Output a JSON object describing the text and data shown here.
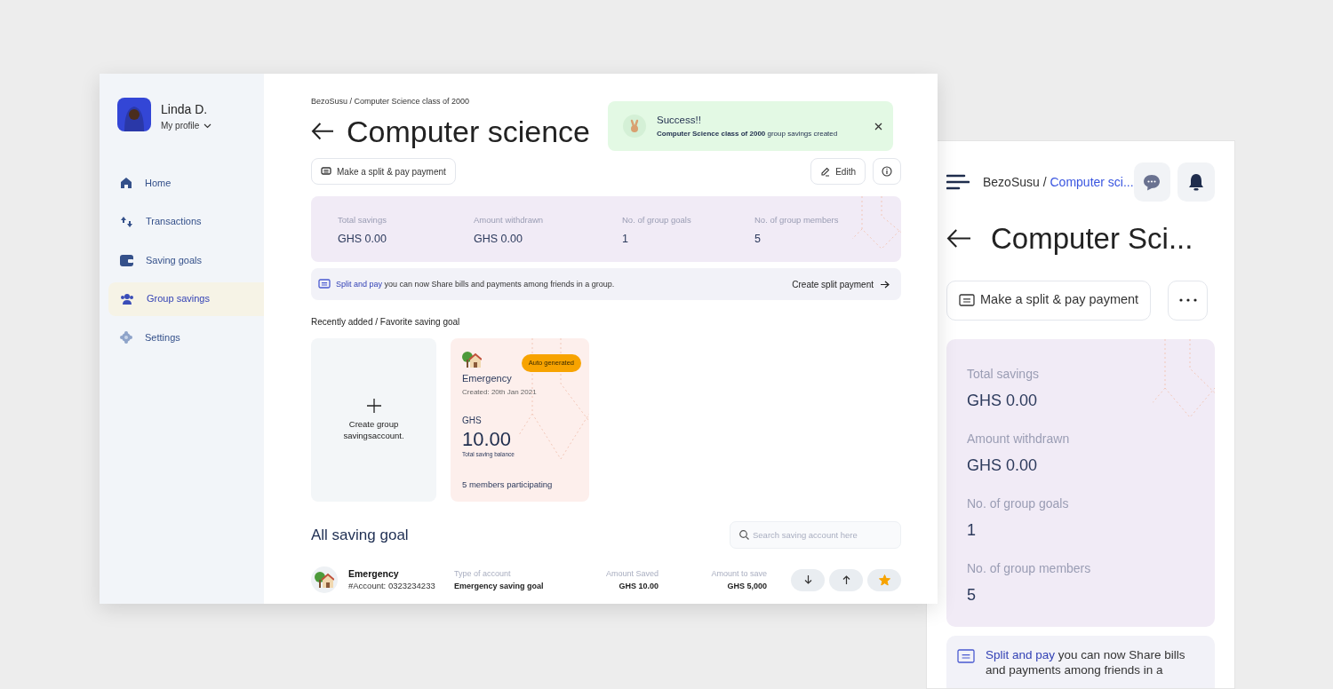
{
  "desktop": {
    "profile": {
      "name": "Linda D.",
      "link": "My profile"
    },
    "nav": [
      {
        "label": "Home",
        "kind": "home",
        "selected": false
      },
      {
        "label": "Transactions",
        "kind": "transactions",
        "selected": false
      },
      {
        "label": "Saving goals",
        "kind": "wallet",
        "selected": false
      },
      {
        "label": "Group savings",
        "kind": "group",
        "selected": true
      },
      {
        "label": "Settings",
        "kind": "settings",
        "selected": false
      }
    ],
    "breadcrumb": {
      "root": "BezoSusu /",
      "current": "Computer Science class of 2000"
    },
    "title": "Computer science",
    "toast": {
      "title": "Success!!",
      "message": "**Computer Science class of 2000** group savings created"
    },
    "split_button": "Make a split & pay payment",
    "edit_button": "Edith",
    "stats": [
      {
        "label": "Total savings",
        "value": "GHS 0.00"
      },
      {
        "label": "Amount withdrawn",
        "value": "GHS 0.00"
      },
      {
        "label": "No. of group goals",
        "value": "1"
      },
      {
        "label": "No. of group members",
        "value": "5"
      }
    ],
    "banner": {
      "highlight": "Split and pay",
      "text": "you can now Share bills and payments among friends in a group.",
      "action": "Create split payment"
    },
    "recent_heading": "Recently added / Favorite saving goal",
    "create_card": "Create group savingsaccount.",
    "goal_cards": [
      {
        "badge": "Auto generated",
        "name": "Emergency",
        "created": "Created: 20th Jan 2021",
        "currency": "GHS",
        "amount": "10.00",
        "amount_label": "Total saving balance",
        "members": "5 members participating"
      }
    ],
    "all_heading": "All saving goal",
    "search": {
      "placeholder": "Search saving account here"
    },
    "goals": [
      {
        "name": "Emergency",
        "account": "#Account: 0323234233",
        "type_label": "Type of account",
        "type": "Emergency saving goal",
        "saved_label": "Amount Saved",
        "saved": "GHS 10.00",
        "target_label": "Amount to save",
        "target": "GHS 5,000",
        "favorite": true
      }
    ]
  },
  "mobile": {
    "breadcrumb": {
      "root": "BezoSusu /",
      "current": "Computer sci..."
    },
    "title": "Computer Sci...",
    "split_button": "Make a split & pay payment",
    "stats": [
      {
        "label": "Total savings",
        "value": "GHS 0.00"
      },
      {
        "label": "Amount withdrawn",
        "value": "GHS 0.00"
      },
      {
        "label": "No. of group goals",
        "value": "1"
      },
      {
        "label": "No. of group members",
        "value": "5"
      }
    ],
    "banner": {
      "highlight": "Split and pay",
      "text": "you can now Share bills and payments among friends in a"
    }
  }
}
